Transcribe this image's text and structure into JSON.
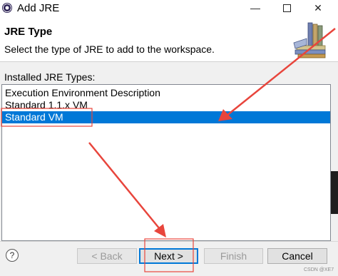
{
  "window": {
    "title": "Add JRE",
    "minimize_glyph": "—",
    "close_glyph": "✕"
  },
  "header": {
    "title": "JRE Type",
    "description": "Select the type of JRE to add to the workspace.",
    "icon": "books-icon"
  },
  "list": {
    "label": "Installed JRE Types:",
    "items": [
      {
        "label": "Execution Environment Description",
        "selected": false
      },
      {
        "label": "Standard 1.1.x VM",
        "selected": false
      },
      {
        "label": "Standard VM",
        "selected": true
      }
    ]
  },
  "footer": {
    "help_glyph": "?",
    "back_label": "< Back",
    "next_label": "Next >",
    "finish_label": "Finish",
    "cancel_label": "Cancel"
  },
  "watermark": "CSDN @XE7",
  "colors": {
    "selection": "#0078d7",
    "annotation": "#e8453c"
  }
}
